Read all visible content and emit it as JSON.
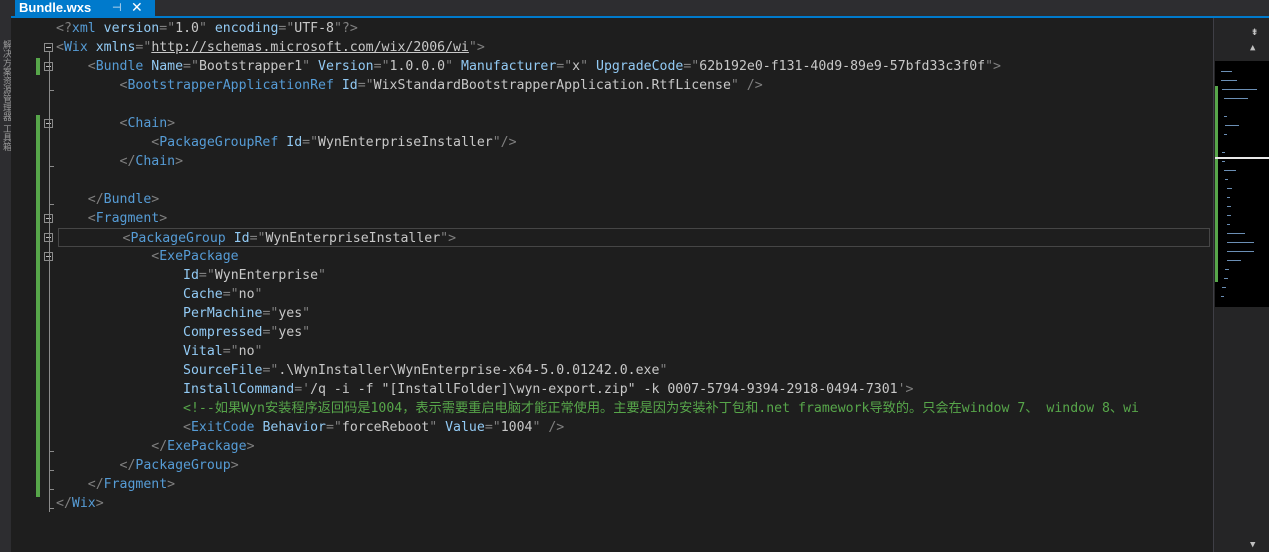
{
  "tab": {
    "title": "Bundle.wxs",
    "pin_glyph": "⊣",
    "close_glyph": "✕"
  },
  "left_panel": {
    "text": "解决方案资源管理器  工具箱"
  },
  "colors": {
    "tag": "#569cd6",
    "attribute": "#92caf4",
    "delimiter": "#808080",
    "value": "#c8c8c8",
    "comment": "#57a64a",
    "background": "#1e1e1e",
    "tab_active": "#007acc"
  },
  "icons": {
    "split": "split-view-icon",
    "scroll_up": "scroll-up-arrow-icon",
    "scroll_down": "scroll-down-arrow-icon"
  },
  "lines": [
    [
      {
        "c": "d",
        "t": "<?"
      },
      {
        "c": "t",
        "t": "xml"
      },
      {
        "c": "a",
        "t": " version"
      },
      {
        "c": "d",
        "t": "=\""
      },
      {
        "c": "v",
        "t": "1.0"
      },
      {
        "c": "d",
        "t": "\""
      },
      {
        "c": "a",
        "t": " encoding"
      },
      {
        "c": "d",
        "t": "=\""
      },
      {
        "c": "v",
        "t": "UTF-8"
      },
      {
        "c": "d",
        "t": "\"?>"
      }
    ],
    [
      {
        "c": "d",
        "t": "<"
      },
      {
        "c": "t",
        "t": "Wix"
      },
      {
        "c": "a",
        "t": " xmlns"
      },
      {
        "c": "d",
        "t": "=\""
      },
      {
        "c": "u",
        "t": "http://schemas.microsoft.com/wix/2006/wi"
      },
      {
        "c": "d",
        "t": "\">"
      }
    ],
    [
      {
        "c": "d",
        "t": "    <"
      },
      {
        "c": "t",
        "t": "Bundle"
      },
      {
        "c": "a",
        "t": " Name"
      },
      {
        "c": "d",
        "t": "=\""
      },
      {
        "c": "v",
        "t": "Bootstrapper1"
      },
      {
        "c": "d",
        "t": "\""
      },
      {
        "c": "a",
        "t": " Version"
      },
      {
        "c": "d",
        "t": "=\""
      },
      {
        "c": "v",
        "t": "1.0.0.0"
      },
      {
        "c": "d",
        "t": "\""
      },
      {
        "c": "a",
        "t": " Manufacturer"
      },
      {
        "c": "d",
        "t": "=\""
      },
      {
        "c": "v",
        "t": "x"
      },
      {
        "c": "d",
        "t": "\""
      },
      {
        "c": "a",
        "t": " UpgradeCode"
      },
      {
        "c": "d",
        "t": "=\""
      },
      {
        "c": "v",
        "t": "62b192e0-f131-40d9-89e9-57bfd33c3f0f"
      },
      {
        "c": "d",
        "t": "\">"
      }
    ],
    [
      {
        "c": "d",
        "t": "        <"
      },
      {
        "c": "t",
        "t": "BootstrapperApplicationRef"
      },
      {
        "c": "a",
        "t": " Id"
      },
      {
        "c": "d",
        "t": "=\""
      },
      {
        "c": "v",
        "t": "WixStandardBootstrapperApplication.RtfLicense"
      },
      {
        "c": "d",
        "t": "\" />"
      }
    ],
    [],
    [
      {
        "c": "d",
        "t": "        <"
      },
      {
        "c": "t",
        "t": "Chain"
      },
      {
        "c": "d",
        "t": ">"
      }
    ],
    [
      {
        "c": "d",
        "t": "            <"
      },
      {
        "c": "t",
        "t": "PackageGroupRef"
      },
      {
        "c": "a",
        "t": " Id"
      },
      {
        "c": "d",
        "t": "=\""
      },
      {
        "c": "v",
        "t": "WynEnterpriseInstaller"
      },
      {
        "c": "d",
        "t": "\"/>"
      }
    ],
    [
      {
        "c": "d",
        "t": "        </"
      },
      {
        "c": "t",
        "t": "Chain"
      },
      {
        "c": "d",
        "t": ">"
      }
    ],
    [],
    [
      {
        "c": "d",
        "t": "    </"
      },
      {
        "c": "t",
        "t": "Bundle"
      },
      {
        "c": "d",
        "t": ">"
      }
    ],
    [
      {
        "c": "d",
        "t": "    <"
      },
      {
        "c": "t",
        "t": "Fragment"
      },
      {
        "c": "d",
        "t": ">"
      }
    ],
    [
      {
        "c": "d",
        "t": "        <"
      },
      {
        "c": "t",
        "t": "PackageGroup"
      },
      {
        "c": "a",
        "t": " Id"
      },
      {
        "c": "d",
        "t": "=\""
      },
      {
        "c": "v",
        "t": "WynEnterpriseInstaller"
      },
      {
        "c": "d",
        "t": "\">"
      }
    ],
    [
      {
        "c": "d",
        "t": "            <"
      },
      {
        "c": "t",
        "t": "ExePackage"
      }
    ],
    [
      {
        "c": "a",
        "t": "                Id"
      },
      {
        "c": "d",
        "t": "=\""
      },
      {
        "c": "v",
        "t": "WynEnterprise"
      },
      {
        "c": "d",
        "t": "\""
      }
    ],
    [
      {
        "c": "a",
        "t": "                Cache"
      },
      {
        "c": "d",
        "t": "=\""
      },
      {
        "c": "v",
        "t": "no"
      },
      {
        "c": "d",
        "t": "\""
      }
    ],
    [
      {
        "c": "a",
        "t": "                PerMachine"
      },
      {
        "c": "d",
        "t": "=\""
      },
      {
        "c": "v",
        "t": "yes"
      },
      {
        "c": "d",
        "t": "\""
      }
    ],
    [
      {
        "c": "a",
        "t": "                Compressed"
      },
      {
        "c": "d",
        "t": "=\""
      },
      {
        "c": "v",
        "t": "yes"
      },
      {
        "c": "d",
        "t": "\""
      }
    ],
    [
      {
        "c": "a",
        "t": "                Vital"
      },
      {
        "c": "d",
        "t": "=\""
      },
      {
        "c": "v",
        "t": "no"
      },
      {
        "c": "d",
        "t": "\""
      }
    ],
    [
      {
        "c": "a",
        "t": "                SourceFile"
      },
      {
        "c": "d",
        "t": "=\""
      },
      {
        "c": "v",
        "t": ".\\WynInstaller\\WynEnterprise-x64-5.0.01242.0.exe"
      },
      {
        "c": "d",
        "t": "\""
      }
    ],
    [
      {
        "c": "a",
        "t": "                InstallCommand"
      },
      {
        "c": "d",
        "t": "='"
      },
      {
        "c": "v",
        "t": "/q -i -f \"[InstallFolder]\\wyn-export.zip\" -k 0007-5794-9394-2918-0494-7301"
      },
      {
        "c": "d",
        "t": "'>"
      }
    ],
    [
      {
        "c": "c",
        "t": "                <!--如果Wyn安装程序返回码是1004，表示需要重启电脑才能正常使用。主要是因为安装补丁包和.net framework导致的。只会在window 7、 window 8、wi"
      }
    ],
    [
      {
        "c": "d",
        "t": "                <"
      },
      {
        "c": "t",
        "t": "ExitCode"
      },
      {
        "c": "a",
        "t": " Behavior"
      },
      {
        "c": "d",
        "t": "=\""
      },
      {
        "c": "v",
        "t": "forceReboot"
      },
      {
        "c": "d",
        "t": "\""
      },
      {
        "c": "a",
        "t": " Value"
      },
      {
        "c": "d",
        "t": "=\""
      },
      {
        "c": "v",
        "t": "1004"
      },
      {
        "c": "d",
        "t": "\" />"
      }
    ],
    [
      {
        "c": "d",
        "t": "            </"
      },
      {
        "c": "t",
        "t": "ExePackage"
      },
      {
        "c": "d",
        "t": ">"
      }
    ],
    [
      {
        "c": "d",
        "t": "        </"
      },
      {
        "c": "t",
        "t": "PackageGroup"
      },
      {
        "c": "d",
        "t": ">"
      }
    ],
    [
      {
        "c": "d",
        "t": "    </"
      },
      {
        "c": "t",
        "t": "Fragment"
      },
      {
        "c": "d",
        "t": ">"
      }
    ],
    [
      {
        "c": "d",
        "t": "</"
      },
      {
        "c": "t",
        "t": "Wix"
      },
      {
        "c": "d",
        "t": ">"
      }
    ]
  ]
}
